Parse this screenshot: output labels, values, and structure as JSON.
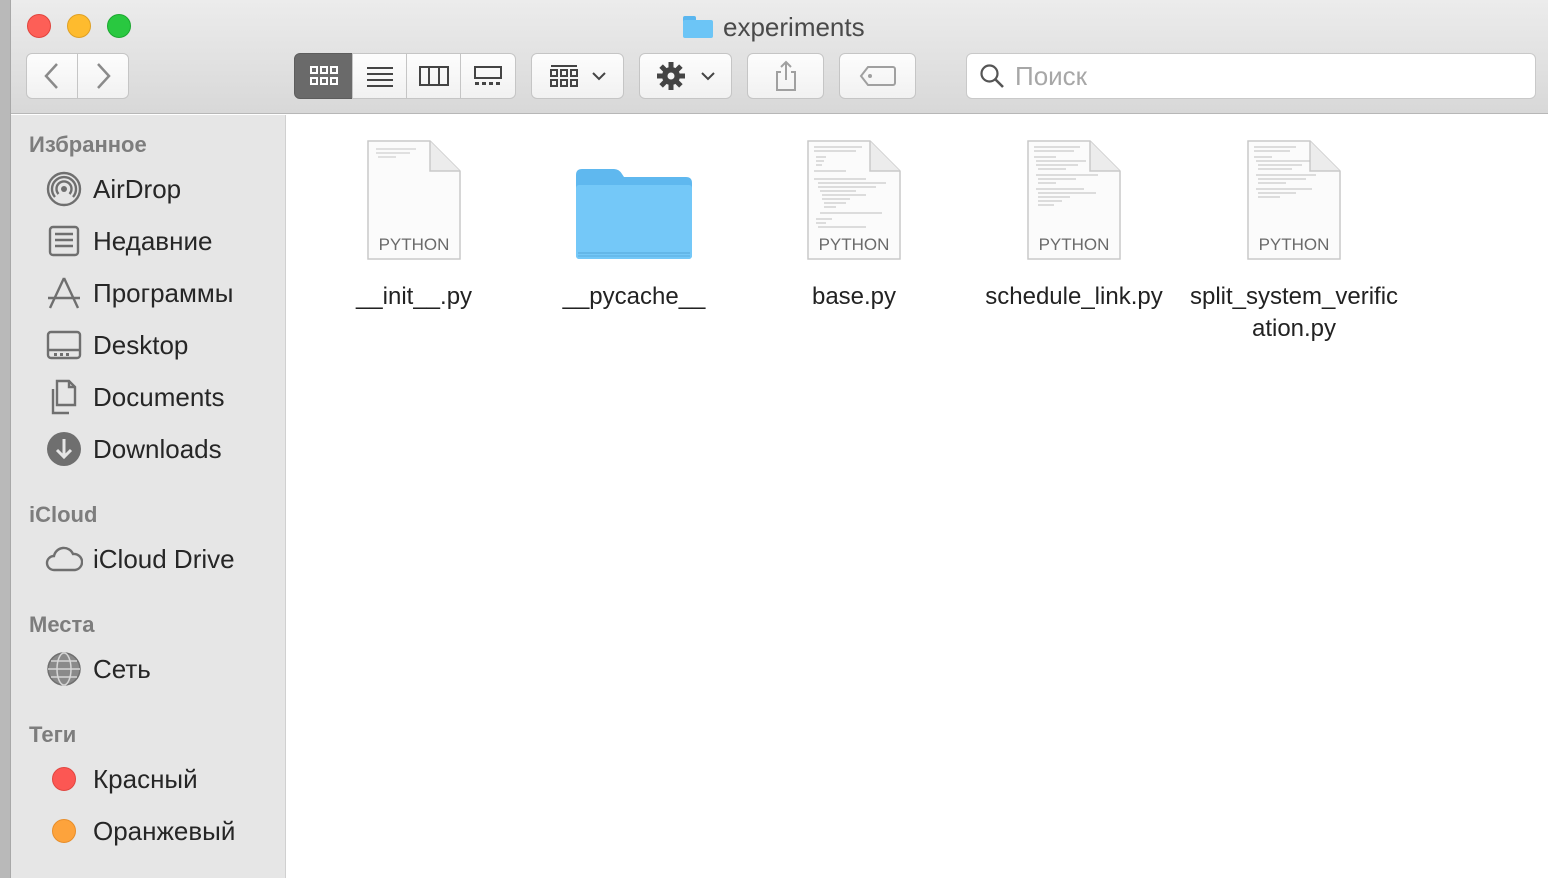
{
  "window": {
    "title": "experiments"
  },
  "toolbar": {
    "search_placeholder": "Поиск"
  },
  "sidebar": {
    "sections": [
      {
        "title": "Избранное"
      },
      {
        "title": "iCloud"
      },
      {
        "title": "Места"
      },
      {
        "title": "Теги"
      }
    ],
    "favorites": [
      {
        "label": "AirDrop",
        "icon": "airdrop-icon"
      },
      {
        "label": "Недавние",
        "icon": "recents-icon"
      },
      {
        "label": "Программы",
        "icon": "applications-icon"
      },
      {
        "label": "Desktop",
        "icon": "desktop-icon"
      },
      {
        "label": "Documents",
        "icon": "documents-icon"
      },
      {
        "label": "Downloads",
        "icon": "downloads-icon"
      }
    ],
    "icloud": [
      {
        "label": "iCloud Drive",
        "icon": "cloud-icon"
      }
    ],
    "places": [
      {
        "label": "Сеть",
        "icon": "network-icon"
      }
    ],
    "tags": [
      {
        "label": "Красный",
        "color": "#fc5753"
      },
      {
        "label": "Оранжевый",
        "color": "#fda33c"
      }
    ]
  },
  "files": [
    {
      "name": "__init__.py",
      "kind": "python",
      "badge": "PYTHON"
    },
    {
      "name": "__pycache__",
      "kind": "folder"
    },
    {
      "name": "base.py",
      "kind": "python",
      "badge": "PYTHON"
    },
    {
      "name": "schedule_link.py",
      "kind": "python",
      "badge": "PYTHON"
    },
    {
      "name": "split_system_verification.py",
      "kind": "python",
      "badge": "PYTHON"
    }
  ]
}
